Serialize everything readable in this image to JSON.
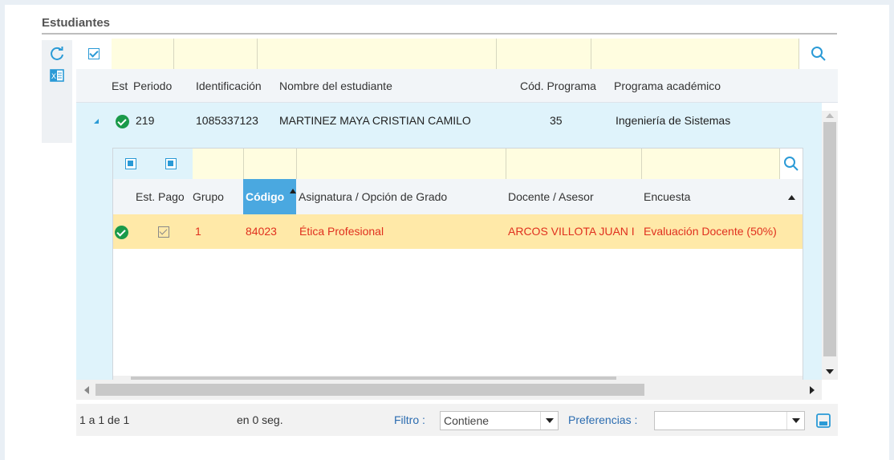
{
  "section": {
    "title": "Estudiantes"
  },
  "toolbar": {
    "refresh_icon": "refresh-icon",
    "excel_icon": "excel-export-icon"
  },
  "master": {
    "columns": [
      "Est",
      "Periodo",
      "Identificación",
      "Nombre del estudiante",
      "Cód. Programa",
      "Programa académico"
    ],
    "row": {
      "periodo": "219",
      "identificacion": "1085337123",
      "nombre": "MARTINEZ MAYA CRISTIAN CAMILO",
      "cod_programa": "35",
      "programa": "Ingeniería de Sistemas"
    }
  },
  "detail": {
    "columns": [
      "Est. Pago",
      "Grupo",
      "Código",
      "Asignatura / Opción de Grado",
      "Docente / Asesor",
      "Encuesta"
    ],
    "row": {
      "grupo": "1",
      "codigo": "84023",
      "asignatura": "Ética Profesional",
      "docente": "ARCOS VILLOTA JUAN I",
      "encuesta": "Evaluación Docente (50%)"
    }
  },
  "footer": {
    "count": "1 a 1 de 1",
    "time": "en 0 seg.",
    "filtro_label": "Filtro :",
    "filtro_value": "Contiene",
    "preferencias_label": "Preferencias :",
    "preferencias_value": ""
  },
  "colors": {
    "filter_bg": "#fffde0",
    "selected_row": "#ffe9a8",
    "master_row": "#dff3fb",
    "accent": "#2a9ad6",
    "error_text": "#e0301e"
  }
}
